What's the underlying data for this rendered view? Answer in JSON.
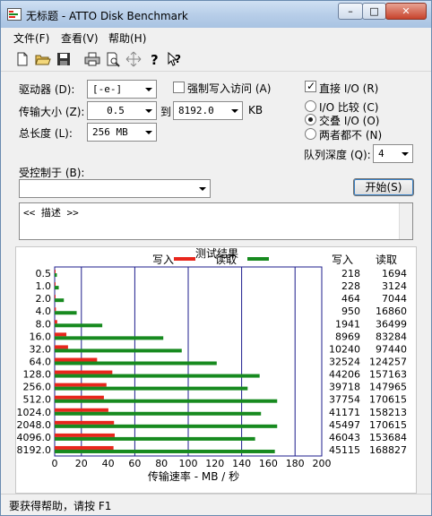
{
  "window": {
    "title": "无标题 - ATTO Disk Benchmark"
  },
  "titlebar_buttons": {
    "minimize": "–",
    "maximize": "□",
    "close": "✕"
  },
  "menu": [
    "文件(F)",
    "查看(V)",
    "帮助(H)"
  ],
  "toolbar_icons": [
    "new-file-icon",
    "open-folder-icon",
    "save-icon",
    "print-icon",
    "print-preview-icon",
    "move-icon",
    "help-icon",
    "context-help-icon"
  ],
  "form": {
    "drive_label": "驱动器 (D):",
    "drive_value": "[-e-]",
    "force_write_label": "强制写入访问 (A)",
    "transfer_label": "传输大小 (Z):",
    "transfer_from": "0.5",
    "to_label": "到",
    "transfer_to": "8192.0",
    "kb_label": "KB",
    "length_label": "总长度 (L):",
    "length_value": "256 MB",
    "direct_io_label": "直接 I/O (R)",
    "io_compare_label": "I/O 比较 (C)",
    "overlapped_label": "交叠 I/O (O)",
    "neither_label": "两者都不 (N)",
    "queue_label": "队列深度 (Q):",
    "queue_value": "4",
    "controlled_label": "受控制于 (B):",
    "controlled_value": "",
    "start_button": "开始(S)",
    "description": "<< 描述 >>"
  },
  "results": {
    "title": "测试结果",
    "legend_write": "写入",
    "legend_read": "读取",
    "col_write": "写入",
    "col_read": "读取"
  },
  "chart_data": {
    "type": "bar",
    "orientation": "horizontal",
    "title": "测试结果",
    "xlabel": "传输速率 - MB / 秒",
    "xlim": [
      0,
      200
    ],
    "x_ticks": [
      0,
      20,
      40,
      60,
      80,
      100,
      120,
      140,
      160,
      180,
      200
    ],
    "categories": [
      "0.5",
      "1.0",
      "2.0",
      "4.0",
      "8.0",
      "16.0",
      "32.0",
      "64.0",
      "128.0",
      "256.0",
      "512.0",
      "1024.0",
      "2048.0",
      "4096.0",
      "8192.0"
    ],
    "series": [
      {
        "name": "写入",
        "color": "#e8261c",
        "values_kb": [
          218,
          228,
          464,
          950,
          1941,
          8969,
          10240,
          32524,
          44206,
          39718,
          37754,
          41171,
          45497,
          46043,
          45115
        ]
      },
      {
        "name": "读取",
        "color": "#178a1f",
        "values_kb": [
          1694,
          3124,
          7044,
          16860,
          36499,
          83284,
          97440,
          124257,
          157163,
          147965,
          170615,
          158213,
          170615,
          153684,
          168827
        ]
      }
    ]
  },
  "status": {
    "text": "要获得帮助，请按 F1"
  },
  "colors": {
    "title_bar": "#b6cde8",
    "grid_line": "#1c1c8c",
    "write_bar": "#e8261c",
    "read_bar": "#178a1f"
  }
}
